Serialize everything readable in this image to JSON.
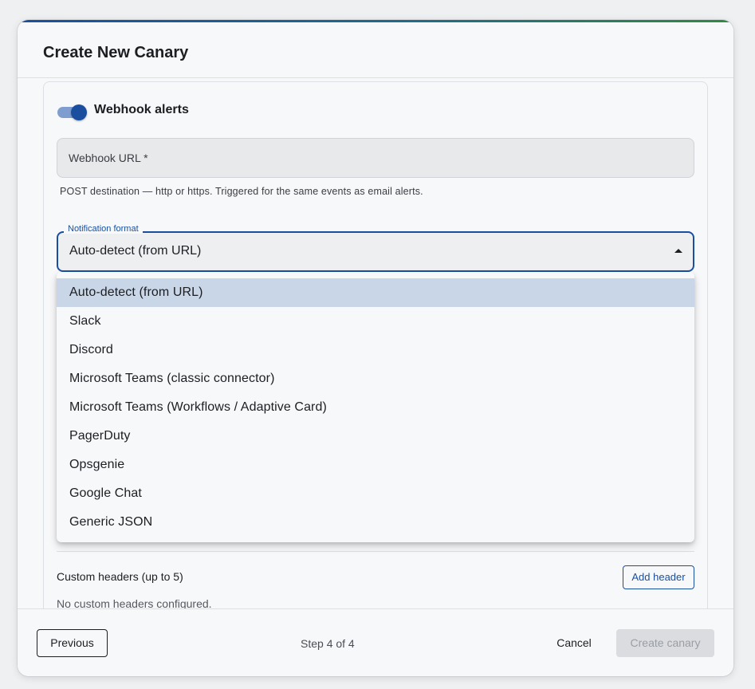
{
  "dialog": {
    "title": "Create New Canary"
  },
  "webhook": {
    "toggle_label": "Webhook alerts",
    "toggle_on": true,
    "url_label": "Webhook URL *",
    "url_help": "POST destination — http or https. Triggered for the same events as email alerts."
  },
  "format": {
    "legend": "Notification format",
    "selected": "Auto-detect (from URL)",
    "options": [
      "Auto-detect (from URL)",
      "Slack",
      "Discord",
      "Microsoft Teams (classic connector)",
      "Microsoft Teams (Workflows / Adaptive Card)",
      "PagerDuty",
      "Opsgenie",
      "Google Chat",
      "Generic JSON"
    ]
  },
  "headers": {
    "label": "Custom headers (up to 5)",
    "add_label": "Add header",
    "empty_text": "No custom headers configured."
  },
  "footer": {
    "previous_label": "Previous",
    "step_text": "Step 4 of 4",
    "cancel_label": "Cancel",
    "create_label": "Create canary"
  },
  "colors": {
    "accent": "#1a4fa0",
    "selected_option_bg": "#c8d6e8",
    "disabled_button_bg": "#dadcdf"
  }
}
